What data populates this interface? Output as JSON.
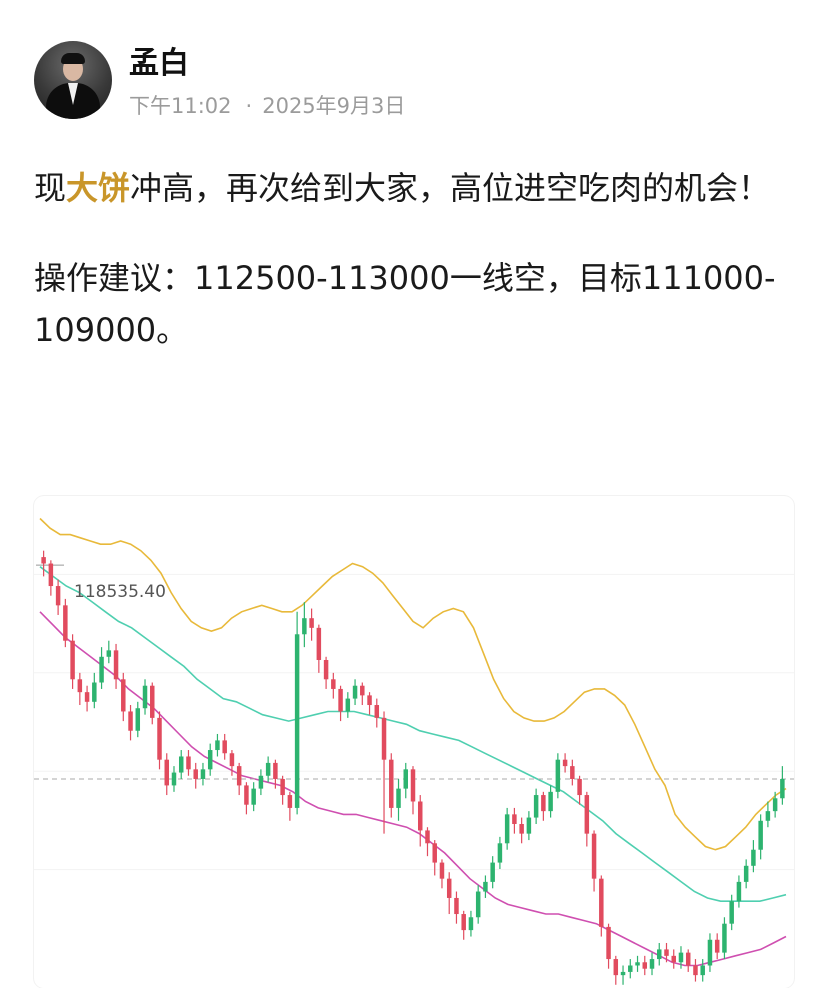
{
  "author": {
    "name": "孟白",
    "avatar_icon": "user-avatar-icon"
  },
  "meta": {
    "time": "下午11:02",
    "separator": "·",
    "date": "2025年9月3日"
  },
  "post": {
    "line1_pre": "现",
    "line1_highlight": "大饼",
    "line1_post": "冲高，再次给到大家，高位进空吃肉的机会！",
    "line2": "操作建议：112500-113000一线空，目标111000-109000。",
    "highlight_color": "#c9962a"
  },
  "chart_data": {
    "type": "candlestick",
    "price_label": "118535.40",
    "colors": {
      "up": "#2db36f",
      "down": "#e14b5e",
      "upper_band": "#e8b93a",
      "middle_band": "#4fcfb0",
      "lower_band": "#cf4fb0",
      "current_price_line": "#aaaaaa"
    },
    "candles": [
      [
        118600,
        118400,
        118800,
        118000
      ],
      [
        118400,
        117700,
        118500,
        117400
      ],
      [
        117700,
        117100,
        117900,
        116800
      ],
      [
        117100,
        116000,
        117300,
        115800
      ],
      [
        116000,
        114800,
        116200,
        114500
      ],
      [
        114800,
        114400,
        115000,
        114000
      ],
      [
        114400,
        114100,
        114600,
        113800
      ],
      [
        114100,
        114700,
        115000,
        113900
      ],
      [
        114700,
        115500,
        115800,
        114500
      ],
      [
        115500,
        115700,
        116000,
        115300
      ],
      [
        115700,
        114800,
        115900,
        114500
      ],
      [
        114800,
        113800,
        115000,
        113500
      ],
      [
        113800,
        113200,
        114000,
        112900
      ],
      [
        113200,
        113900,
        114100,
        113000
      ],
      [
        113900,
        114600,
        114800,
        113700
      ],
      [
        114600,
        113600,
        114700,
        113400
      ],
      [
        113600,
        112300,
        113800,
        112000
      ],
      [
        112300,
        111500,
        112500,
        111200
      ],
      [
        111500,
        111900,
        112100,
        111300
      ],
      [
        111900,
        112400,
        112600,
        111700
      ],
      [
        112400,
        112000,
        112600,
        111800
      ],
      [
        112000,
        111700,
        112200,
        111400
      ],
      [
        111700,
        112000,
        112200,
        111500
      ],
      [
        112000,
        112600,
        112800,
        111800
      ],
      [
        112600,
        112900,
        113100,
        112400
      ],
      [
        112900,
        112500,
        113100,
        112300
      ],
      [
        112500,
        112100,
        112600,
        111800
      ],
      [
        112100,
        111500,
        112200,
        111200
      ],
      [
        111500,
        110900,
        111600,
        110600
      ],
      [
        110900,
        111400,
        111600,
        110700
      ],
      [
        111400,
        111800,
        112000,
        111200
      ],
      [
        111800,
        112200,
        112400,
        111600
      ],
      [
        112200,
        111700,
        112300,
        111400
      ],
      [
        111700,
        111200,
        111800,
        110900
      ],
      [
        111200,
        110800,
        111300,
        110400
      ],
      [
        110800,
        116200,
        116900,
        110600
      ],
      [
        116200,
        116700,
        117200,
        115800
      ],
      [
        116700,
        116400,
        117000,
        116000
      ],
      [
        116400,
        115400,
        116500,
        115000
      ],
      [
        115400,
        114800,
        115500,
        114500
      ],
      [
        114800,
        114500,
        115000,
        114200
      ],
      [
        114500,
        113800,
        114600,
        113500
      ],
      [
        113800,
        114200,
        114400,
        113600
      ],
      [
        114200,
        114600,
        114800,
        114000
      ],
      [
        114600,
        114300,
        114700,
        114000
      ],
      [
        114300,
        114000,
        114400,
        113700
      ],
      [
        114000,
        113600,
        114200,
        113300
      ],
      [
        113600,
        112300,
        113800,
        110000
      ],
      [
        112300,
        110800,
        112500,
        110500
      ],
      [
        110800,
        111400,
        111700,
        110400
      ],
      [
        111400,
        112000,
        112200,
        111100
      ],
      [
        112000,
        111000,
        112100,
        110600
      ],
      [
        111000,
        110100,
        111200,
        109600
      ],
      [
        110100,
        109700,
        110200,
        109300
      ],
      [
        109700,
        109100,
        109800,
        108700
      ],
      [
        109100,
        108600,
        109200,
        108300
      ],
      [
        108600,
        108000,
        108800,
        107500
      ],
      [
        108000,
        107500,
        108200,
        107200
      ],
      [
        107500,
        107000,
        107600,
        106700
      ],
      [
        107000,
        107400,
        107600,
        106800
      ],
      [
        107400,
        108200,
        108400,
        107200
      ],
      [
        108200,
        108500,
        108700,
        108000
      ],
      [
        108500,
        109100,
        109300,
        108300
      ],
      [
        109100,
        109700,
        109900,
        108900
      ],
      [
        109700,
        110600,
        110800,
        109500
      ],
      [
        110600,
        110300,
        110800,
        110000
      ],
      [
        110300,
        110000,
        110500,
        109700
      ],
      [
        110000,
        110500,
        110700,
        109800
      ],
      [
        110500,
        111200,
        111400,
        110300
      ],
      [
        111200,
        110700,
        111300,
        110400
      ],
      [
        110700,
        111300,
        111500,
        110500
      ],
      [
        111300,
        112300,
        112500,
        111100
      ],
      [
        112300,
        112100,
        112500,
        111900
      ],
      [
        112100,
        111700,
        112300,
        111500
      ],
      [
        111700,
        111200,
        111800,
        110900
      ],
      [
        111200,
        110000,
        111300,
        109600
      ],
      [
        110000,
        108600,
        110100,
        108200
      ],
      [
        108600,
        107100,
        108700,
        106800
      ],
      [
        107100,
        106100,
        107200,
        105800
      ],
      [
        106100,
        105600,
        106200,
        105300
      ],
      [
        105600,
        105700,
        105900,
        105300
      ],
      [
        105700,
        105900,
        106100,
        105500
      ],
      [
        105900,
        106000,
        106200,
        105700
      ],
      [
        106000,
        105800,
        106200,
        105600
      ],
      [
        105800,
        106100,
        106300,
        105600
      ],
      [
        106100,
        106400,
        106600,
        105900
      ],
      [
        106400,
        106200,
        106600,
        106000
      ],
      [
        106200,
        106000,
        106400,
        105800
      ],
      [
        106000,
        106300,
        106500,
        105800
      ],
      [
        106300,
        105900,
        106400,
        105700
      ],
      [
        105900,
        105600,
        106100,
        105400
      ],
      [
        105600,
        105900,
        106100,
        105400
      ],
      [
        105900,
        106700,
        106900,
        105700
      ],
      [
        106700,
        106300,
        106900,
        106100
      ],
      [
        106300,
        107200,
        107400,
        106100
      ],
      [
        107200,
        107900,
        108100,
        107000
      ],
      [
        107900,
        108500,
        108700,
        107700
      ],
      [
        108500,
        109000,
        109200,
        108300
      ],
      [
        109000,
        109500,
        109800,
        108800
      ],
      [
        109500,
        110400,
        110600,
        109200
      ],
      [
        110400,
        110700,
        111000,
        110200
      ],
      [
        110700,
        111100,
        111300,
        110500
      ],
      [
        111100,
        111700,
        112100,
        110900
      ]
    ],
    "upper_band": [
      119800,
      119500,
      119300,
      119300,
      119200,
      119100,
      119000,
      119000,
      119100,
      119000,
      118800,
      118500,
      118100,
      117500,
      117000,
      116600,
      116400,
      116300,
      116400,
      116700,
      116900,
      117000,
      117100,
      117000,
      116900,
      116900,
      117100,
      117400,
      117700,
      118000,
      118200,
      118400,
      118300,
      118100,
      117800,
      117400,
      117000,
      116600,
      116400,
      116700,
      116900,
      117000,
      116900,
      116400,
      115600,
      114800,
      114200,
      113800,
      113600,
      113500,
      113500,
      113600,
      113800,
      114100,
      114400,
      114500,
      114500,
      114300,
      114000,
      113400,
      112700,
      112000,
      111500,
      110600,
      110200,
      109900,
      109600,
      109500,
      109600,
      109900,
      110200,
      110600,
      110900,
      111200,
      111400
    ],
    "middle_band": [
      118300,
      118000,
      117700,
      117500,
      117200,
      116900,
      116600,
      116400,
      116100,
      115800,
      115500,
      115200,
      114800,
      114500,
      114200,
      114100,
      113900,
      113700,
      113600,
      113500,
      113600,
      113700,
      113800,
      113800,
      113800,
      113700,
      113600,
      113500,
      113400,
      113200,
      113100,
      113000,
      112900,
      112700,
      112500,
      112300,
      112100,
      111900,
      111700,
      111500,
      111300,
      111000,
      110700,
      110400,
      110000,
      109700,
      109400,
      109100,
      108800,
      108500,
      108200,
      108000,
      107900,
      107900,
      107900,
      107900,
      108000,
      108100
    ],
    "lower_band": [
      116900,
      116500,
      116100,
      115800,
      115500,
      115200,
      114900,
      114500,
      114200,
      113900,
      113500,
      113100,
      112700,
      112400,
      112200,
      112000,
      111800,
      111700,
      111600,
      111500,
      111300,
      111000,
      110800,
      110700,
      110600,
      110600,
      110500,
      110400,
      110300,
      110200,
      110000,
      109700,
      109400,
      109000,
      108600,
      108300,
      108000,
      107800,
      107700,
      107600,
      107500,
      107500,
      107400,
      107300,
      107200,
      107000,
      106800,
      106600,
      106400,
      106200,
      106000,
      105900,
      105900,
      106000,
      106100,
      106200,
      106300,
      106400,
      106600,
      106800
    ],
    "current_price": 111700,
    "ylim": [
      105200,
      120500
    ]
  }
}
